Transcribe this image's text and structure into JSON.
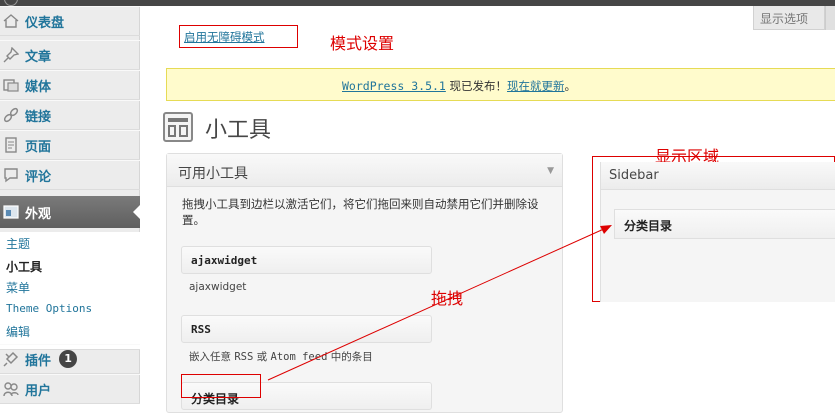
{
  "sidebar": {
    "items": [
      {
        "label": "仪表盘",
        "icon": "dashboard-icon"
      },
      {
        "label": "文章",
        "icon": "pin-icon"
      },
      {
        "label": "媒体",
        "icon": "media-icon"
      },
      {
        "label": "链接",
        "icon": "link-icon"
      },
      {
        "label": "页面",
        "icon": "page-icon"
      },
      {
        "label": "评论",
        "icon": "comment-icon"
      },
      {
        "label": "外观",
        "icon": "appearance-icon"
      },
      {
        "label": "插件",
        "icon": "plugin-icon",
        "badge": "1"
      },
      {
        "label": "用户",
        "icon": "users-icon"
      }
    ],
    "submenu": [
      "主题",
      "小工具",
      "菜单",
      "Theme Options",
      "编辑"
    ]
  },
  "header": {
    "accessibility_link": "启用无障碍模式",
    "screen_options": "显示选项"
  },
  "update_nag": {
    "version": "WordPress 3.5.1",
    "text": " 现已发布！",
    "link": "现在就更新",
    "end": "。"
  },
  "page": {
    "title": "小工具"
  },
  "available": {
    "title": "可用小工具",
    "desc": "拖拽小工具到边栏以激活它们，将它们拖回来则自动禁用它们并删除设置。",
    "widgets": [
      {
        "title": "ajaxwidget",
        "desc": "ajaxwidget"
      },
      {
        "title": "RSS",
        "desc_a": "嵌入任意 ",
        "desc_b": "RSS",
        "desc_c": " 或 ",
        "desc_d": "Atom feed",
        "desc_e": " 中的条目"
      },
      {
        "title": "分类目录"
      }
    ]
  },
  "sidebar_area": {
    "title": "Sidebar",
    "widget": "分类目录"
  },
  "annotations": {
    "mode": "模式设置",
    "display": "显示区域",
    "drag": "拖拽"
  },
  "colors": {
    "annotation": "#dd0000",
    "link": "#21759b",
    "nag_bg": "#fffbcc"
  }
}
